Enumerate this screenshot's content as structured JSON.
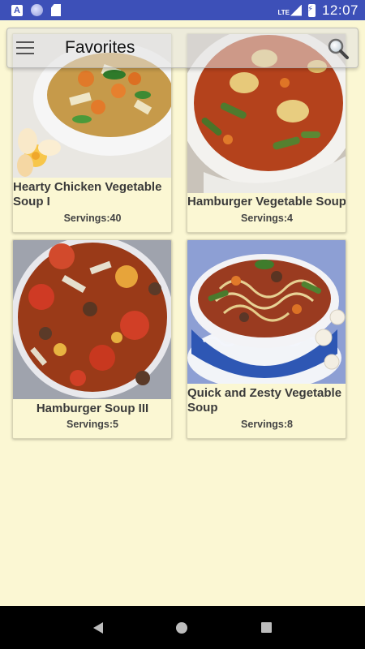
{
  "status_bar": {
    "icons": [
      "notification-a-icon",
      "sync-circle-icon",
      "sd-card-icon",
      "lte-signal-icon",
      "battery-charging-icon"
    ],
    "lte_label": "LTE",
    "a_label": "A",
    "time": "12:07",
    "color": "#3d50b8"
  },
  "app_bar": {
    "title": "Favorites",
    "menu_icon": "hamburger-menu-icon",
    "search_icon": "search-icon"
  },
  "favorites": [
    {
      "title": "Hearty Chicken Vegetable Soup I",
      "servings": "Servings:40"
    },
    {
      "title": "Hamburger Vegetable Soup",
      "servings": "Servings:4"
    },
    {
      "title": "Hamburger Soup III",
      "servings": "Servings:5"
    },
    {
      "title": "Quick and Zesty Vegetable Soup",
      "servings": "Servings:8"
    }
  ],
  "nav_bar": {
    "icons": [
      "back-icon",
      "home-icon",
      "recents-icon"
    ]
  },
  "colors": {
    "background": "#fbf7d3",
    "status_bar": "#3d50b8",
    "nav_bar": "#000000"
  }
}
